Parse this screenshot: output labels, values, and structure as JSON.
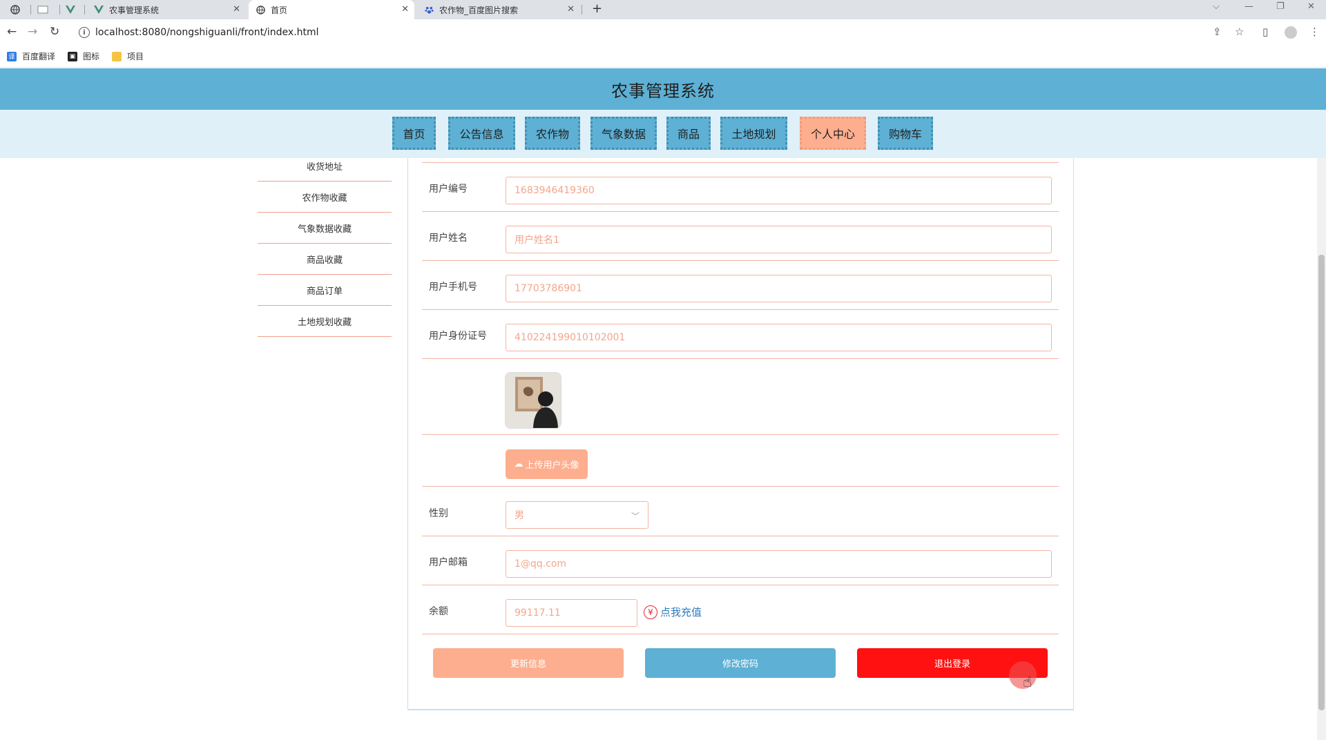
{
  "browser": {
    "tabs": [
      {
        "title": "农事管理系统"
      },
      {
        "title": "首页"
      },
      {
        "title": "农作物_百度图片搜索"
      }
    ],
    "url": "localhost:8080/nongshiguanli/front/index.html",
    "bookmarks": [
      {
        "label": "百度翻译"
      },
      {
        "label": "图标"
      },
      {
        "label": "项目"
      }
    ]
  },
  "header": {
    "title": "农事管理系统"
  },
  "nav": {
    "items": [
      "首页",
      "公告信息",
      "农作物",
      "气象数据",
      "商品",
      "土地规划",
      "个人中心",
      "购物车"
    ],
    "active": "个人中心"
  },
  "sidebar": {
    "items": [
      "收货地址",
      "农作物收藏",
      "气象数据收藏",
      "商品收藏",
      "商品订单",
      "土地规划收藏"
    ]
  },
  "form": {
    "user_no": {
      "label": "用户编号",
      "value": "1683946419360"
    },
    "user_name": {
      "label": "用户姓名",
      "value": "用户姓名1"
    },
    "phone": {
      "label": "用户手机号",
      "value": "17703786901"
    },
    "id_card": {
      "label": "用户身份证号",
      "value": "410224199010102001"
    },
    "upload_label": "上传用户头像",
    "gender": {
      "label": "性别",
      "value": "男"
    },
    "email": {
      "label": "用户邮箱",
      "value": "1@qq.com"
    },
    "balance": {
      "label": "余额",
      "value": "99117.11"
    },
    "recharge_label": "点我充值"
  },
  "actions": {
    "update": "更新信息",
    "change_password": "修改密码",
    "logout": "退出登录"
  },
  "colors": {
    "header": "#5eb0d4",
    "nav_strip": "#dff0f8",
    "accent": "#fdae8f",
    "logout": "#ff1111",
    "link": "#2e7bbd"
  }
}
